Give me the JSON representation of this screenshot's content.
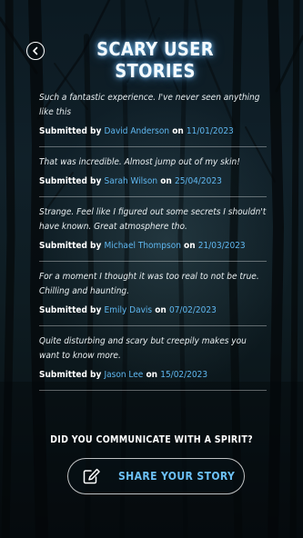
{
  "header": {
    "title": "SCARY USER STORIES"
  },
  "stories": [
    {
      "text": "Such a fantastic experience. I've never seen anything like this",
      "submitted_by_label": "Submitted by",
      "name": "David Anderson",
      "on_label": "on",
      "date": "11/01/2023"
    },
    {
      "text": "That was incredible. Almost jump out of my skin!",
      "submitted_by_label": "Submitted by",
      "name": "Sarah Wilson",
      "on_label": "on",
      "date": "25/04/2023"
    },
    {
      "text": "Strange. Feel like I figured out some secrets I shouldn't have known. Great atmosphere tho.",
      "submitted_by_label": "Submitted by",
      "name": "Michael Thompson",
      "on_label": "on",
      "date": "21/03/2023"
    },
    {
      "text": "For a moment I thought it was too real to not be true. Chilling and haunting.",
      "submitted_by_label": "Submitted by",
      "name": "Emily Davis",
      "on_label": "on",
      "date": "07/02/2023"
    },
    {
      "text": "Quite disturbing and scary but creepily makes you want to know more.",
      "submitted_by_label": "Submitted by",
      "name": "Jason Lee",
      "on_label": "on",
      "date": "15/02/2023"
    }
  ],
  "cta": {
    "question": "DID YOU COMMUNICATE WITH A SPIRIT?",
    "button_label": "SHARE YOUR STORY"
  },
  "icons": {
    "back": "chevron-left-icon",
    "share": "pen-edit-icon"
  },
  "colors": {
    "accent": "#5fb7f0",
    "title_glow": "#78c8ff"
  }
}
